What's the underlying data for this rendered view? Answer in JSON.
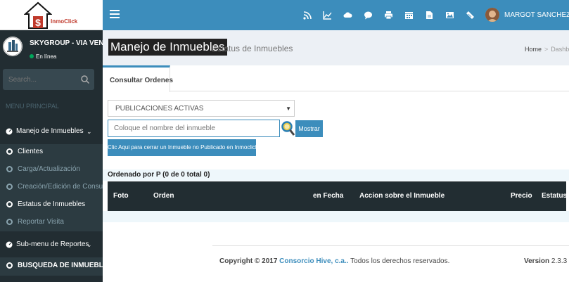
{
  "logo": {
    "text": "InmoClick"
  },
  "user": {
    "name": "SKYGROUP - VIA VENETO",
    "status": "En línea"
  },
  "search": {
    "placeholder": "Search..."
  },
  "menu": {
    "header": "MENU PRINCIPAL",
    "manejo": {
      "label": "Manejo de Inmuebles"
    },
    "subitems": [
      {
        "label": "Clientes"
      },
      {
        "label": "Carga/Actualización"
      },
      {
        "label": "Creación/Edición de Consultas"
      },
      {
        "label": "Estatus de Inmuebles"
      },
      {
        "label": "Reportar Visita"
      }
    ],
    "submenu_reportes": {
      "label": "Sub-menu de Reportes"
    },
    "busqueda": {
      "label": "BUSQUEDA DE INMUEBLES"
    }
  },
  "topbar": {
    "username": "MARGOT SANCHEZ",
    "icons": [
      "rss-icon",
      "chart-line-icon",
      "cloud-icon",
      "comment-icon",
      "print-icon",
      "calendar-icon",
      "file-icon",
      "image-icon",
      "ticket-icon"
    ]
  },
  "page": {
    "title": "Manejo de Inmuebles",
    "subtitle": "Estatus de Inmuebles",
    "breadcrumb_home": "Home",
    "breadcrumb_current": "Dashboard"
  },
  "tabs": {
    "active": "Consultar Ordenes"
  },
  "form": {
    "select_value": "PUBLICACIONES ACTIVAS",
    "input_placeholder": "Coloque el nombre del inmueble",
    "mostrar_label": "Mostrar",
    "cerrar_label": "Clic Aqui para cerrar un Inmueble no Publicado en Inmoclick"
  },
  "table": {
    "order_label": "Ordenado por P (0 de 0 total 0)",
    "columns": [
      "Foto",
      "Orden",
      "en Fecha",
      "Accion sobre el Inmueble",
      "Precio",
      "Estatus"
    ]
  },
  "footer": {
    "copyright_prefix": "Copyright © 2017",
    "company": "Consorcio Hive, c.a..",
    "rights": "Todos los derechos reservados.",
    "version_label": "Version",
    "version_number": "2.3.3"
  },
  "colors": {
    "sidebar": "#222d32",
    "topbar": "#3c8dbc",
    "accent": "#3c8dbc"
  }
}
